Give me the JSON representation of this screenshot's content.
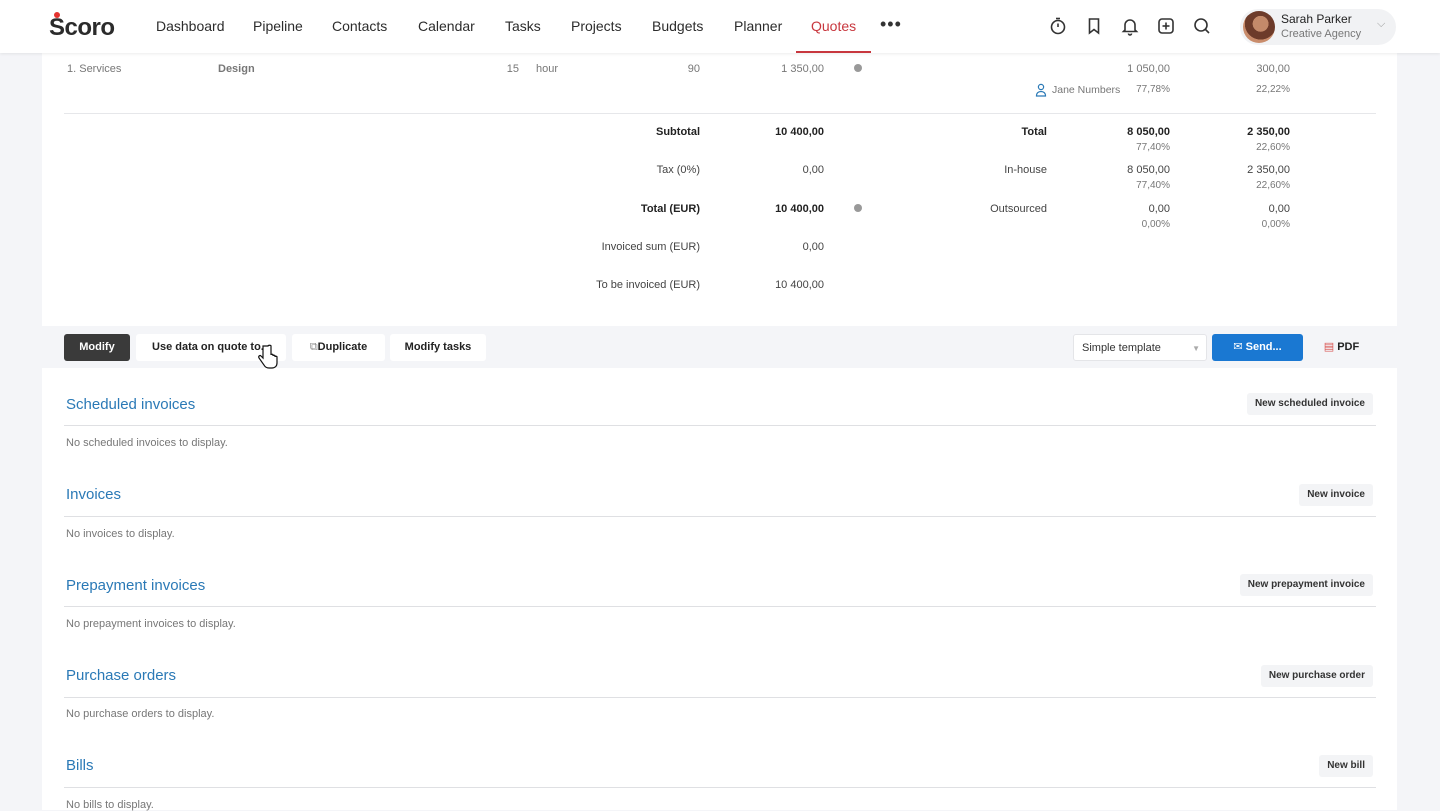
{
  "app": {
    "logo": "Scoro"
  },
  "nav": [
    {
      "label": "Dashboard",
      "active": false
    },
    {
      "label": "Pipeline",
      "active": false
    },
    {
      "label": "Contacts",
      "active": false
    },
    {
      "label": "Calendar",
      "active": false
    },
    {
      "label": "Tasks",
      "active": false
    },
    {
      "label": "Projects",
      "active": false
    },
    {
      "label": "Budgets",
      "active": false
    },
    {
      "label": "Planner",
      "active": false
    },
    {
      "label": "Quotes",
      "active": true
    }
  ],
  "header_icons": [
    "more-icon",
    "timer-icon",
    "bookmark-icon",
    "bell-icon",
    "add-icon",
    "search-icon"
  ],
  "user": {
    "name": "Sarah Parker",
    "org": "Creative Agency"
  },
  "line_item": {
    "name": "1. Services",
    "product": "Design",
    "qty": "15",
    "unit": "hour",
    "price": "90",
    "sum": "1 350,00",
    "cost": "1 050,00",
    "margin": "300,00",
    "assignee": "Jane Numbers",
    "assignee_pct": "77,78%",
    "margin_pct": "22,22%"
  },
  "summary": [
    {
      "label": "Subtotal",
      "value": "10 400,00",
      "bold": true
    },
    {
      "label": "Tax (0%)",
      "value": "0,00",
      "bold": false
    },
    {
      "label": "Total (EUR)",
      "value": "10 400,00",
      "bold": true
    },
    {
      "label": "Invoiced sum (EUR)",
      "value": "0,00",
      "bold": false
    },
    {
      "label": "To be invoiced (EUR)",
      "value": "10 400,00",
      "bold": false
    }
  ],
  "profit": [
    {
      "label": "Total",
      "cost": "8 050,00",
      "cost_pct": "77,40%",
      "margin": "2 350,00",
      "margin_pct": "22,60%",
      "bold": true
    },
    {
      "label": "In-house",
      "cost": "8 050,00",
      "cost_pct": "77,40%",
      "margin": "2 350,00",
      "margin_pct": "22,60%",
      "bold": false
    },
    {
      "label": "Outsourced",
      "cost": "0,00",
      "cost_pct": "0,00%",
      "margin": "0,00",
      "margin_pct": "0,00%",
      "bold": false
    }
  ],
  "actions": {
    "modify": "Modify",
    "use_data": "Use data on quote to...",
    "duplicate": "Duplicate",
    "modify_tasks": "Modify tasks",
    "template": "Simple template",
    "send": "Send...",
    "pdf": "PDF"
  },
  "sections": [
    {
      "title": "Scheduled invoices",
      "button": "New scheduled invoice",
      "empty": "No scheduled invoices to display."
    },
    {
      "title": "Invoices",
      "button": "New invoice",
      "empty": "No invoices to display."
    },
    {
      "title": "Prepayment invoices",
      "button": "New prepayment invoice",
      "empty": "No prepayment invoices to display."
    },
    {
      "title": "Purchase orders",
      "button": "New purchase order",
      "empty": "No purchase orders to display."
    },
    {
      "title": "Bills",
      "button": "New bill",
      "empty": "No bills to display."
    }
  ],
  "colors": {
    "accent": "#c8373e",
    "link": "#2a79b6",
    "primary": "#1a78d2"
  }
}
